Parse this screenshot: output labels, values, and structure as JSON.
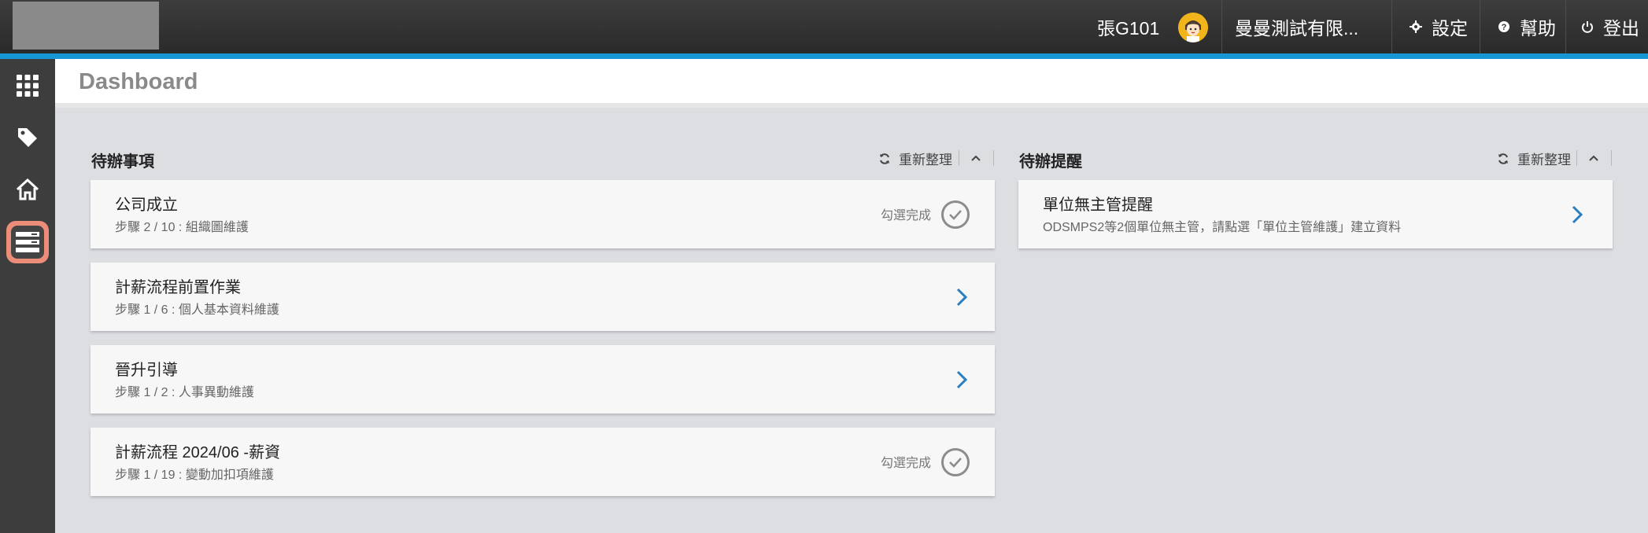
{
  "header": {
    "user_name": "張G101",
    "company": "曼曼測試有限...",
    "settings_label": "設定",
    "help_label": "幫助",
    "logout_label": "登出"
  },
  "sidebar": {
    "items": [
      {
        "icon": "apps-grid-icon"
      },
      {
        "icon": "tag-icon"
      },
      {
        "icon": "home-icon"
      },
      {
        "icon": "dashboard-list-icon",
        "active": true
      }
    ]
  },
  "page": {
    "title": "Dashboard"
  },
  "todo_panel": {
    "title": "待辦事項",
    "refresh_label": "重新整理",
    "items": [
      {
        "title": "公司成立",
        "subtitle": "步驟 2 / 10 : 組織圖維護",
        "action": "check",
        "action_label": "勾選完成"
      },
      {
        "title": "計薪流程前置作業",
        "subtitle": "步驟 1 / 6 : 個人基本資料維護",
        "action": "arrow"
      },
      {
        "title": "晉升引導",
        "subtitle": "步驟 1 / 2 : 人事異動維護",
        "action": "arrow"
      },
      {
        "title": "計薪流程 2024/06 -薪資",
        "subtitle": "步驟 1 / 19 : 變動加扣項維護",
        "action": "check",
        "action_label": "勾選完成"
      }
    ]
  },
  "reminder_panel": {
    "title": "待辦提醒",
    "refresh_label": "重新整理",
    "items": [
      {
        "title": "單位無主管提醒",
        "subtitle": "ODSMPS2等2個單位無主管，請點選「單位主管維護」建立資料",
        "action": "arrow"
      }
    ]
  },
  "colors": {
    "accent": "#1796d6",
    "arrow": "#2b7fc0",
    "active_sidebar": "#ec8d7a"
  }
}
